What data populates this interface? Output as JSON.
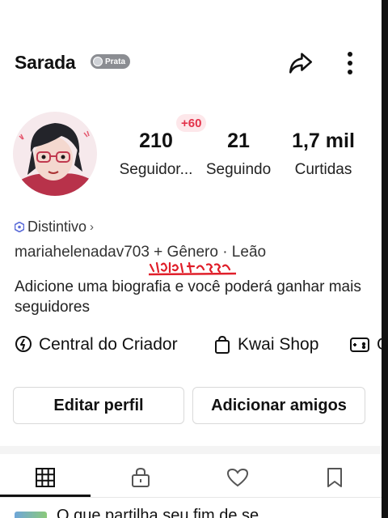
{
  "header": {
    "title": "Sarada",
    "badge": "Prata",
    "share_icon": "share-arrow-icon",
    "more_icon": "more-vertical-icon"
  },
  "stats": {
    "new_followers": "+60",
    "followers_count": "210",
    "followers_label": "Seguidor...",
    "following_count": "21",
    "following_label": "Seguindo",
    "likes_count": "1,7 mil",
    "likes_label": "Curtidas"
  },
  "profile": {
    "distintivo": "Distintivo",
    "username_line": "mariahelenadav703 + Gênero · Leão",
    "stamp": "ja foi isso",
    "bio": "Adicione uma biografia e você poderá ganhar mais seguidores"
  },
  "shortcuts": [
    {
      "label": "Central do Criador",
      "icon": "creator-bulb-icon"
    },
    {
      "label": "Kwai Shop",
      "icon": "shopping-bag-icon"
    },
    {
      "label": "G",
      "icon": "gamepad-icon"
    }
  ],
  "actions": {
    "edit_profile": "Editar perfil",
    "add_friends": "Adicionar amigos"
  },
  "tabs": [
    {
      "name": "grid",
      "icon": "grid-icon"
    },
    {
      "name": "private",
      "icon": "lock-icon"
    },
    {
      "name": "liked",
      "icon": "heart-icon"
    },
    {
      "name": "saved",
      "icon": "bookmark-icon"
    }
  ],
  "feed_peek": {
    "text": "O que partilha seu fim de se"
  },
  "colors": {
    "accent_red": "#e3324a",
    "badge_gray": "#8b8d92",
    "hex_blue": "#5a6bd8"
  }
}
